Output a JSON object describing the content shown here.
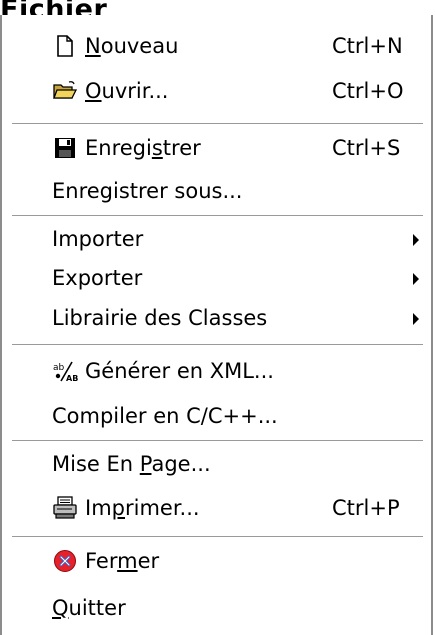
{
  "menu": {
    "title": "Fichier",
    "items": [
      {
        "id": "nouveau",
        "before": "",
        "mnemonic": "N",
        "after": "ouveau",
        "shortcut": "Ctrl+N",
        "icon": "new-document-icon"
      },
      {
        "id": "ouvrir",
        "before": "",
        "mnemonic": "O",
        "after": "uvrir...",
        "shortcut": "Ctrl+O",
        "icon": "open-folder-icon"
      },
      {
        "id": "enregistrer",
        "before": "Enregi",
        "mnemonic": "s",
        "after": "trer",
        "shortcut": "Ctrl+S",
        "icon": "save-disk-icon"
      },
      {
        "id": "enregistrer-sous",
        "before": "Enregistrer sous...",
        "mnemonic": "",
        "after": "",
        "shortcut": ""
      },
      {
        "id": "importer",
        "before": "Importer",
        "mnemonic": "",
        "after": "",
        "shortcut": ""
      },
      {
        "id": "exporter",
        "before": "Exporter",
        "mnemonic": "",
        "after": "",
        "shortcut": ""
      },
      {
        "id": "librairie",
        "before": "Librairie des Classes",
        "mnemonic": "",
        "after": "",
        "shortcut": ""
      },
      {
        "id": "generer-xml",
        "before": "Générer en XML...",
        "mnemonic": "",
        "after": "",
        "shortcut": "",
        "icon": "generate-xml-icon"
      },
      {
        "id": "compiler",
        "before": "Compiler en C/C++...",
        "mnemonic": "",
        "after": "",
        "shortcut": ""
      },
      {
        "id": "mise-en-page",
        "before": "Mise En ",
        "mnemonic": "P",
        "after": "age...",
        "shortcut": ""
      },
      {
        "id": "imprimer",
        "before": "Im",
        "mnemonic": "p",
        "after": "rimer...",
        "shortcut": "Ctrl+P",
        "icon": "printer-icon"
      },
      {
        "id": "fermer",
        "before": "Fer",
        "mnemonic": "m",
        "after": "er",
        "shortcut": "",
        "icon": "close-red-icon"
      },
      {
        "id": "quitter",
        "before": "",
        "mnemonic": "Q",
        "after": "uitter",
        "shortcut": ""
      }
    ]
  },
  "colors": {
    "close_icon_red": "#e8202a",
    "close_icon_blue": "#3a5fcd",
    "folder_yellow": "#f2d45c",
    "separator": "#9a9a9a"
  }
}
